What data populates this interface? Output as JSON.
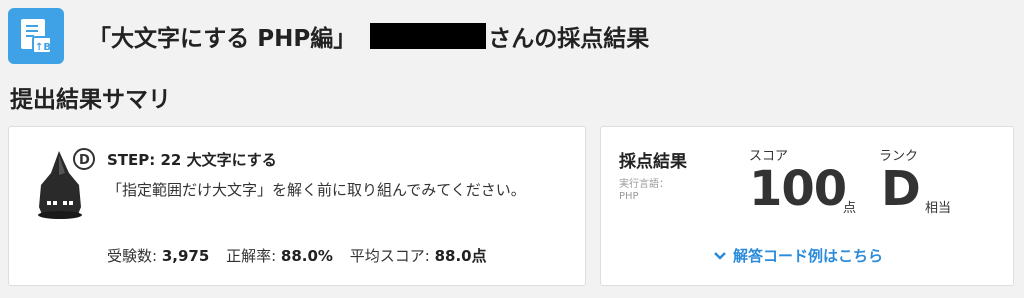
{
  "header": {
    "title_prefix": "「大文字にする PHP編」",
    "title_suffix": "さんの採点結果",
    "icon_color": "#3fa2e6"
  },
  "section": {
    "title": "提出結果サマリ"
  },
  "step": {
    "badge": "D",
    "title": "STEP: 22 大文字にする",
    "description": "「指定範囲だけ大文字」を解く前に取り組んでみてください。",
    "stats": [
      {
        "label": "受験数:",
        "value": "3,975"
      },
      {
        "label": "正解率:",
        "value": "88.0%"
      },
      {
        "label": "平均スコア:",
        "value": "88.0点"
      }
    ]
  },
  "result": {
    "title": "採点結果",
    "language_label": "実行言語：",
    "language": "PHP",
    "score_label": "スコア",
    "score": "100",
    "score_unit": "点",
    "rank_label": "ランク",
    "rank": "D",
    "rank_unit": "相当",
    "answer_link": "解答コード例はこちら",
    "link_color": "#2b8cdb"
  }
}
